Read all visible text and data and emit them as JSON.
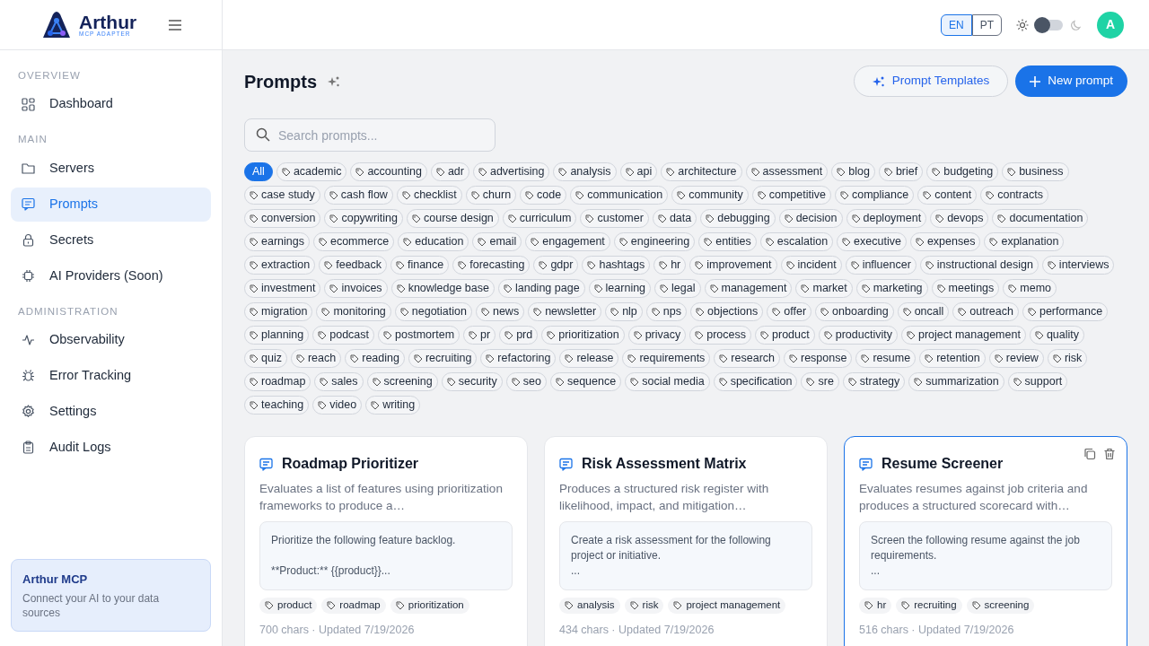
{
  "brand": {
    "name": "Arthur",
    "subtitle": "MCP ADAPTER"
  },
  "sidebar": {
    "sections": [
      {
        "title": "OVERVIEW",
        "items": [
          {
            "label": "Dashboard",
            "selected": false
          }
        ]
      },
      {
        "title": "MAIN",
        "items": [
          {
            "label": "Servers",
            "selected": false
          },
          {
            "label": "Prompts",
            "selected": true
          },
          {
            "label": "Secrets",
            "selected": false
          },
          {
            "label": "AI Providers (Soon)",
            "selected": false
          }
        ]
      },
      {
        "title": "ADMINISTRATION",
        "items": [
          {
            "label": "Observability",
            "selected": false
          },
          {
            "label": "Error Tracking",
            "selected": false
          },
          {
            "label": "Settings",
            "selected": false
          },
          {
            "label": "Audit Logs",
            "selected": false
          }
        ]
      }
    ],
    "promo": {
      "title": "Arthur MCP",
      "text": "Connect your AI to your data sources"
    }
  },
  "header": {
    "languages": [
      {
        "label": "EN",
        "selected": true
      },
      {
        "label": "PT",
        "selected": false
      }
    ],
    "dark_mode": false,
    "avatar": "A"
  },
  "page": {
    "title": "Prompts",
    "templates_button": "Prompt Templates",
    "new_button": "New prompt",
    "search": {
      "placeholder": "Search prompts..."
    }
  },
  "filters": [
    {
      "label": "All",
      "kind": "all",
      "selected": true
    },
    {
      "label": "academic",
      "kind": "tag",
      "selected": false
    },
    {
      "label": "accounting",
      "kind": "tag",
      "selected": false
    },
    {
      "label": "adr",
      "kind": "tag",
      "selected": false
    },
    {
      "label": "advertising",
      "kind": "tag",
      "selected": false
    },
    {
      "label": "analysis",
      "kind": "tag",
      "selected": false
    },
    {
      "label": "api",
      "kind": "tag",
      "selected": false
    },
    {
      "label": "architecture",
      "kind": "tag",
      "selected": false
    },
    {
      "label": "assessment",
      "kind": "tag",
      "selected": false
    },
    {
      "label": "blog",
      "kind": "tag",
      "selected": false
    },
    {
      "label": "brief",
      "kind": "tag",
      "selected": false
    },
    {
      "label": "budgeting",
      "kind": "tag",
      "selected": false
    },
    {
      "label": "business",
      "kind": "tag",
      "selected": false
    },
    {
      "label": "case study",
      "kind": "tag",
      "selected": false
    },
    {
      "label": "cash flow",
      "kind": "tag",
      "selected": false
    },
    {
      "label": "checklist",
      "kind": "tag",
      "selected": false
    },
    {
      "label": "churn",
      "kind": "tag",
      "selected": false
    },
    {
      "label": "code",
      "kind": "tag",
      "selected": false
    },
    {
      "label": "communication",
      "kind": "tag",
      "selected": false
    },
    {
      "label": "community",
      "kind": "tag",
      "selected": false
    },
    {
      "label": "competitive",
      "kind": "tag",
      "selected": false
    },
    {
      "label": "compliance",
      "kind": "tag",
      "selected": false
    },
    {
      "label": "content",
      "kind": "tag",
      "selected": false
    },
    {
      "label": "contracts",
      "kind": "tag",
      "selected": false
    },
    {
      "label": "conversion",
      "kind": "tag",
      "selected": false
    },
    {
      "label": "copywriting",
      "kind": "tag",
      "selected": false
    },
    {
      "label": "course design",
      "kind": "tag",
      "selected": false
    },
    {
      "label": "curriculum",
      "kind": "tag",
      "selected": false
    },
    {
      "label": "customer",
      "kind": "tag",
      "selected": false
    },
    {
      "label": "data",
      "kind": "tag",
      "selected": false
    },
    {
      "label": "debugging",
      "kind": "tag",
      "selected": false
    },
    {
      "label": "decision",
      "kind": "tag",
      "selected": false
    },
    {
      "label": "deployment",
      "kind": "tag",
      "selected": false
    },
    {
      "label": "devops",
      "kind": "tag",
      "selected": false
    },
    {
      "label": "documentation",
      "kind": "tag",
      "selected": false
    },
    {
      "label": "earnings",
      "kind": "tag",
      "selected": false
    },
    {
      "label": "ecommerce",
      "kind": "tag",
      "selected": false
    },
    {
      "label": "education",
      "kind": "tag",
      "selected": false
    },
    {
      "label": "email",
      "kind": "tag",
      "selected": false
    },
    {
      "label": "engagement",
      "kind": "tag",
      "selected": false
    },
    {
      "label": "engineering",
      "kind": "tag",
      "selected": false
    },
    {
      "label": "entities",
      "kind": "tag",
      "selected": false
    },
    {
      "label": "escalation",
      "kind": "tag",
      "selected": false
    },
    {
      "label": "executive",
      "kind": "tag",
      "selected": false
    },
    {
      "label": "expenses",
      "kind": "tag",
      "selected": false
    },
    {
      "label": "explanation",
      "kind": "tag",
      "selected": false
    },
    {
      "label": "extraction",
      "kind": "tag",
      "selected": false
    },
    {
      "label": "feedback",
      "kind": "tag",
      "selected": false
    },
    {
      "label": "finance",
      "kind": "tag",
      "selected": false
    },
    {
      "label": "forecasting",
      "kind": "tag",
      "selected": false
    },
    {
      "label": "gdpr",
      "kind": "tag",
      "selected": false
    },
    {
      "label": "hashtags",
      "kind": "tag",
      "selected": false
    },
    {
      "label": "hr",
      "kind": "tag",
      "selected": false
    },
    {
      "label": "improvement",
      "kind": "tag",
      "selected": false
    },
    {
      "label": "incident",
      "kind": "tag",
      "selected": false
    },
    {
      "label": "influencer",
      "kind": "tag",
      "selected": false
    },
    {
      "label": "instructional design",
      "kind": "tag",
      "selected": false
    },
    {
      "label": "interviews",
      "kind": "tag",
      "selected": false
    },
    {
      "label": "investment",
      "kind": "tag",
      "selected": false
    },
    {
      "label": "invoices",
      "kind": "tag",
      "selected": false
    },
    {
      "label": "knowledge base",
      "kind": "tag",
      "selected": false
    },
    {
      "label": "landing page",
      "kind": "tag",
      "selected": false
    },
    {
      "label": "learning",
      "kind": "tag",
      "selected": false
    },
    {
      "label": "legal",
      "kind": "tag",
      "selected": false
    },
    {
      "label": "management",
      "kind": "tag",
      "selected": false
    },
    {
      "label": "market",
      "kind": "tag",
      "selected": false
    },
    {
      "label": "marketing",
      "kind": "tag",
      "selected": false
    },
    {
      "label": "meetings",
      "kind": "tag",
      "selected": false
    },
    {
      "label": "memo",
      "kind": "tag",
      "selected": false
    },
    {
      "label": "migration",
      "kind": "tag",
      "selected": false
    },
    {
      "label": "monitoring",
      "kind": "tag",
      "selected": false
    },
    {
      "label": "negotiation",
      "kind": "tag",
      "selected": false
    },
    {
      "label": "news",
      "kind": "tag",
      "selected": false
    },
    {
      "label": "newsletter",
      "kind": "tag",
      "selected": false
    },
    {
      "label": "nlp",
      "kind": "tag",
      "selected": false
    },
    {
      "label": "nps",
      "kind": "tag",
      "selected": false
    },
    {
      "label": "objections",
      "kind": "tag",
      "selected": false
    },
    {
      "label": "offer",
      "kind": "tag",
      "selected": false
    },
    {
      "label": "onboarding",
      "kind": "tag",
      "selected": false
    },
    {
      "label": "oncall",
      "kind": "tag",
      "selected": false
    },
    {
      "label": "outreach",
      "kind": "tag",
      "selected": false
    },
    {
      "label": "performance",
      "kind": "tag",
      "selected": false
    },
    {
      "label": "planning",
      "kind": "tag",
      "selected": false
    },
    {
      "label": "podcast",
      "kind": "tag",
      "selected": false
    },
    {
      "label": "postmortem",
      "kind": "tag",
      "selected": false
    },
    {
      "label": "pr",
      "kind": "tag",
      "selected": false
    },
    {
      "label": "prd",
      "kind": "tag",
      "selected": false
    },
    {
      "label": "prioritization",
      "kind": "tag",
      "selected": false
    },
    {
      "label": "privacy",
      "kind": "tag",
      "selected": false
    },
    {
      "label": "process",
      "kind": "tag",
      "selected": false
    },
    {
      "label": "product",
      "kind": "tag",
      "selected": false
    },
    {
      "label": "productivity",
      "kind": "tag",
      "selected": false
    },
    {
      "label": "project management",
      "kind": "tag",
      "selected": false
    },
    {
      "label": "quality",
      "kind": "tag",
      "selected": false
    },
    {
      "label": "quiz",
      "kind": "tag",
      "selected": false
    },
    {
      "label": "reach",
      "kind": "tag",
      "selected": false
    },
    {
      "label": "reading",
      "kind": "tag",
      "selected": false
    },
    {
      "label": "recruiting",
      "kind": "tag",
      "selected": false
    },
    {
      "label": "refactoring",
      "kind": "tag",
      "selected": false
    },
    {
      "label": "release",
      "kind": "tag",
      "selected": false
    },
    {
      "label": "requirements",
      "kind": "tag",
      "selected": false
    },
    {
      "label": "research",
      "kind": "tag",
      "selected": false
    },
    {
      "label": "response",
      "kind": "tag",
      "selected": false
    },
    {
      "label": "resume",
      "kind": "tag",
      "selected": false
    },
    {
      "label": "retention",
      "kind": "tag",
      "selected": false
    },
    {
      "label": "review",
      "kind": "tag",
      "selected": false
    },
    {
      "label": "risk",
      "kind": "tag",
      "selected": false
    },
    {
      "label": "roadmap",
      "kind": "tag",
      "selected": false
    },
    {
      "label": "sales",
      "kind": "tag",
      "selected": false
    },
    {
      "label": "screening",
      "kind": "tag",
      "selected": false
    },
    {
      "label": "security",
      "kind": "tag",
      "selected": false
    },
    {
      "label": "seo",
      "kind": "tag",
      "selected": false
    },
    {
      "label": "sequence",
      "kind": "tag",
      "selected": false
    },
    {
      "label": "social media",
      "kind": "tag",
      "selected": false
    },
    {
      "label": "specification",
      "kind": "tag",
      "selected": false
    },
    {
      "label": "sre",
      "kind": "tag",
      "selected": false
    },
    {
      "label": "strategy",
      "kind": "tag",
      "selected": false
    },
    {
      "label": "summarization",
      "kind": "tag",
      "selected": false
    },
    {
      "label": "support",
      "kind": "tag",
      "selected": false
    },
    {
      "label": "teaching",
      "kind": "tag",
      "selected": false
    },
    {
      "label": "video",
      "kind": "tag",
      "selected": false
    },
    {
      "label": "writing",
      "kind": "tag",
      "selected": false
    }
  ],
  "cards": [
    {
      "title": "Roadmap Prioritizer",
      "description": "Evaluates a list of features using prioritization frameworks to produce a…",
      "preview": "Prioritize the following feature backlog.\n\n**Product:** {{product}}...",
      "tags": [
        "product",
        "roadmap",
        "prioritization"
      ],
      "meta": "700 chars · Updated 7/19/2026",
      "selected": false
    },
    {
      "title": "Risk Assessment Matrix",
      "description": "Produces a structured risk register with likelihood, impact, and mitigation…",
      "preview": "Create a risk assessment for the following project or initiative.\n...",
      "tags": [
        "analysis",
        "risk",
        "project management"
      ],
      "meta": "434 chars · Updated 7/19/2026",
      "selected": false
    },
    {
      "title": "Resume Screener",
      "description": "Evaluates resumes against job criteria and produces a structured scorecard with…",
      "preview": "Screen the following resume against the job requirements.\n...",
      "tags": [
        "hr",
        "recruiting",
        "screening"
      ],
      "meta": "516 chars · Updated 7/19/2026",
      "selected": true
    }
  ]
}
